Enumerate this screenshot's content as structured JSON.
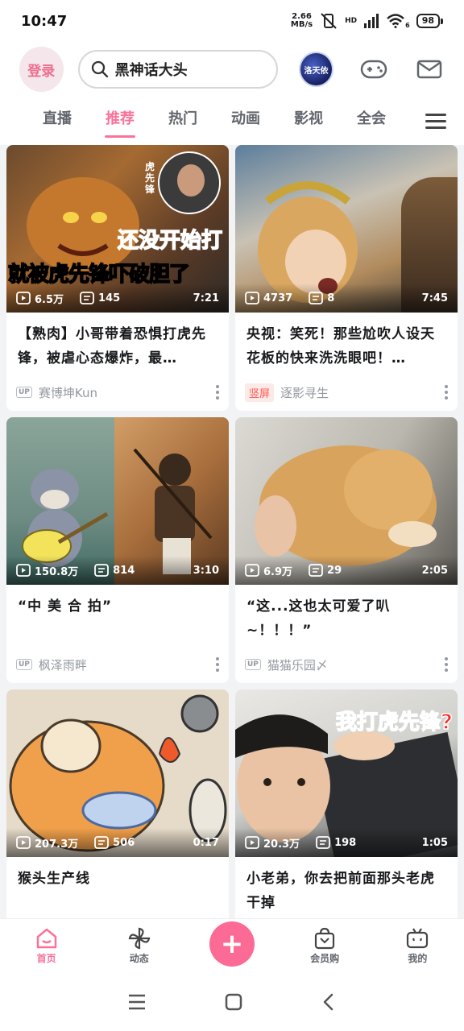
{
  "status_bar": {
    "time": "10:47",
    "net_speed_value": "2.66",
    "net_speed_unit": "MB/s",
    "signal_label": "HD",
    "wifi_label": "6",
    "battery": "98"
  },
  "header": {
    "login_label": "登录",
    "search_text": "黑神话大头",
    "avatar_text": "洛天依"
  },
  "tabs": [
    {
      "label": "直播"
    },
    {
      "label": "推荐"
    },
    {
      "label": "热门"
    },
    {
      "label": "动画"
    },
    {
      "label": "影视"
    },
    {
      "label": "全会"
    }
  ],
  "cards": [
    {
      "views": "6.5万",
      "danmaku": "145",
      "duration": "7:21",
      "title": "【熟肉】小哥带着恐惧打虎先锋，被虐心态爆炸，最…",
      "author": "赛博坤Kun",
      "badge": "",
      "overlay_line1": "还没开始打",
      "overlay_line2": "就被虎先锋吓破胆了",
      "overlay_side": "虎先锋"
    },
    {
      "views": "4737",
      "danmaku": "8",
      "duration": "7:45",
      "title": "央视：笑死！那些尬吹人设天花板的快来洗洗眼吧！…",
      "author": "逐影寻生",
      "badge": "竖屏"
    },
    {
      "views": "150.8万",
      "danmaku": "814",
      "duration": "3:10",
      "title": "“中 美 合 拍”",
      "author": "枫泽雨畔",
      "badge": ""
    },
    {
      "views": "6.9万",
      "danmaku": "29",
      "duration": "2:05",
      "title": "“这...这也太可爱了叭~！！！”",
      "author": "猫猫乐园〆",
      "badge": ""
    },
    {
      "views": "207.3万",
      "danmaku": "506",
      "duration": "0:17",
      "title": "猴头生产线",
      "author": "",
      "badge": ""
    },
    {
      "views": "20.3万",
      "danmaku": "198",
      "duration": "1:05",
      "title": "小老弟，你去把前面那头老虎干掉",
      "author": "",
      "badge": "",
      "overlay_line1": "我打虎先锋?"
    }
  ],
  "bottom_nav": [
    {
      "label": "首页",
      "icon": "home-icon"
    },
    {
      "label": "动态",
      "icon": "pinwheel-icon"
    },
    {
      "label": "",
      "icon": "plus-icon"
    },
    {
      "label": "会员购",
      "icon": "shopping-bag-icon"
    },
    {
      "label": "我的",
      "icon": "tv-icon"
    }
  ],
  "colors": {
    "accent": "#fb7299",
    "text": "#18191c",
    "muted": "#9499a0"
  }
}
